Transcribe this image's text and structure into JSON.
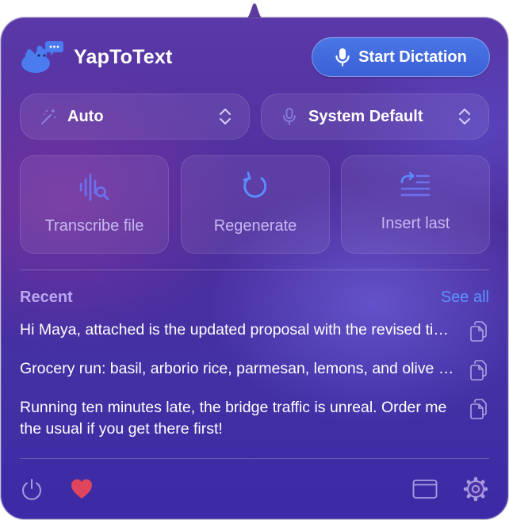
{
  "app": {
    "title": "YapToText"
  },
  "header": {
    "dictate_label": "Start Dictation"
  },
  "selectors": {
    "mode": {
      "value": "Auto",
      "icon": "magic-wand-icon"
    },
    "microphone": {
      "value": "System Default",
      "icon": "microphone-icon"
    }
  },
  "actions": [
    {
      "label": "Transcribe file",
      "icon": "waveform-search-icon"
    },
    {
      "label": "Regenerate",
      "icon": "regenerate-icon"
    },
    {
      "label": "Insert last",
      "icon": "insert-text-icon"
    }
  ],
  "recent": {
    "label": "Recent",
    "see_all": "See all",
    "items": [
      {
        "text": "Hi Maya, attached is the updated proposal with the revised timeline and budget notes."
      },
      {
        "text": "Grocery run: basil, arborio rice, parmesan, lemons, and olive oil."
      },
      {
        "text": "Running ten minutes late, the bridge traffic is unreal. Order me the usual if you get there first!"
      }
    ]
  },
  "footer": {
    "icons": [
      "power-icon",
      "heart-icon",
      "window-icon",
      "gear-icon"
    ]
  },
  "colors": {
    "accent": "#3f68dc",
    "link": "#5a93ff",
    "heart": "#e0455e",
    "section_label": "#b9a8f0",
    "tile_label": "#c7b7f2"
  }
}
